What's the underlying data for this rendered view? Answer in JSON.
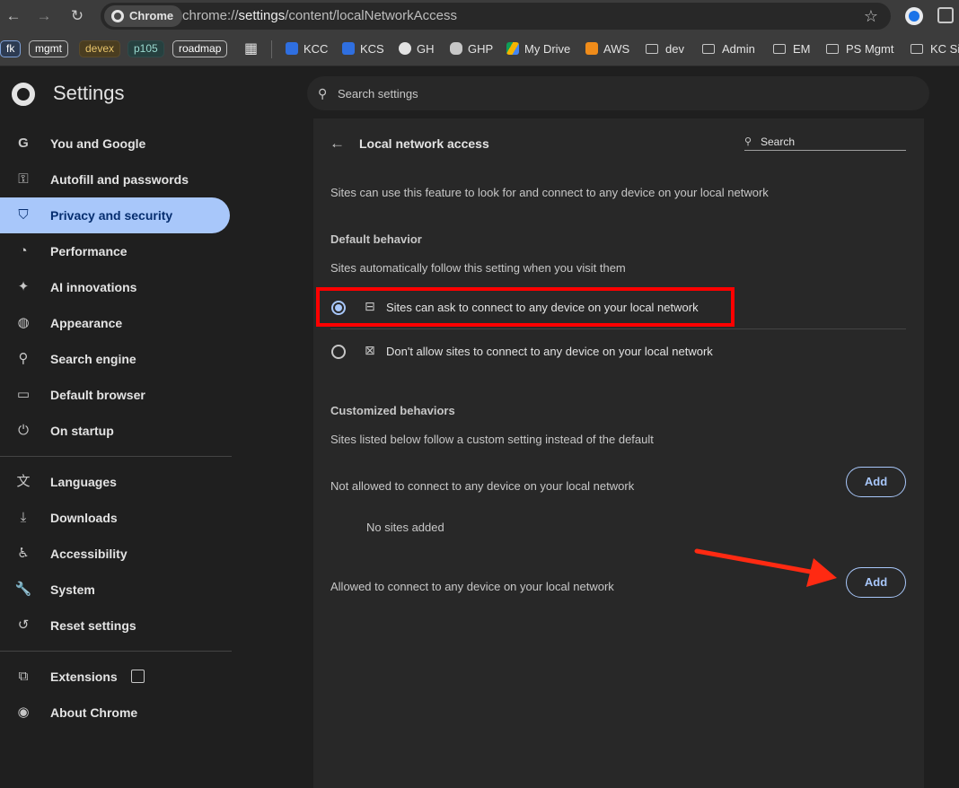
{
  "browser": {
    "chip_label": "Chrome",
    "url_prefix": "chrome://",
    "url_host": "settings",
    "url_path": "/content/localNetworkAccess"
  },
  "bookmarks": [
    {
      "label": "fk"
    },
    {
      "label": "mgmt"
    },
    {
      "label": "devex"
    },
    {
      "label": "p105"
    },
    {
      "label": "roadmap"
    },
    {
      "label": "KCC"
    },
    {
      "label": "KCS"
    },
    {
      "label": "GH"
    },
    {
      "label": "GHP"
    },
    {
      "label": "My Drive"
    },
    {
      "label": "AWS"
    },
    {
      "label": "dev"
    },
    {
      "label": "Admin"
    },
    {
      "label": "EM"
    },
    {
      "label": "PS Mgmt"
    },
    {
      "label": "KC Si"
    }
  ],
  "header": {
    "title": "Settings",
    "search_placeholder": "Search settings"
  },
  "sidebar": {
    "items": [
      {
        "label": "You and Google"
      },
      {
        "label": "Autofill and passwords"
      },
      {
        "label": "Privacy and security"
      },
      {
        "label": "Performance"
      },
      {
        "label": "AI innovations"
      },
      {
        "label": "Appearance"
      },
      {
        "label": "Search engine"
      },
      {
        "label": "Default browser"
      },
      {
        "label": "On startup"
      },
      {
        "label": "Languages"
      },
      {
        "label": "Downloads"
      },
      {
        "label": "Accessibility"
      },
      {
        "label": "System"
      },
      {
        "label": "Reset settings"
      },
      {
        "label": "Extensions"
      },
      {
        "label": "About Chrome"
      }
    ],
    "active_index": 2
  },
  "page": {
    "title": "Local network access",
    "search_placeholder": "Search",
    "description": "Sites can use this feature to look for and connect to any device on your local network",
    "default_header": "Default behavior",
    "default_sub": "Sites automatically follow this setting when you visit them",
    "option_allow": "Sites can ask to connect to any device on your local network",
    "option_block": "Don't allow sites to connect to any device on your local network",
    "custom_header": "Customized behaviors",
    "custom_sub": "Sites listed below follow a custom setting instead of the default",
    "not_allowed_label": "Not allowed to connect to any device on your local network",
    "no_sites": "No sites added",
    "allowed_label": "Allowed to connect to any device on your local network",
    "add_label": "Add"
  },
  "colors": {
    "accent": "#a8c7fa",
    "annotation": "#ff0000"
  }
}
